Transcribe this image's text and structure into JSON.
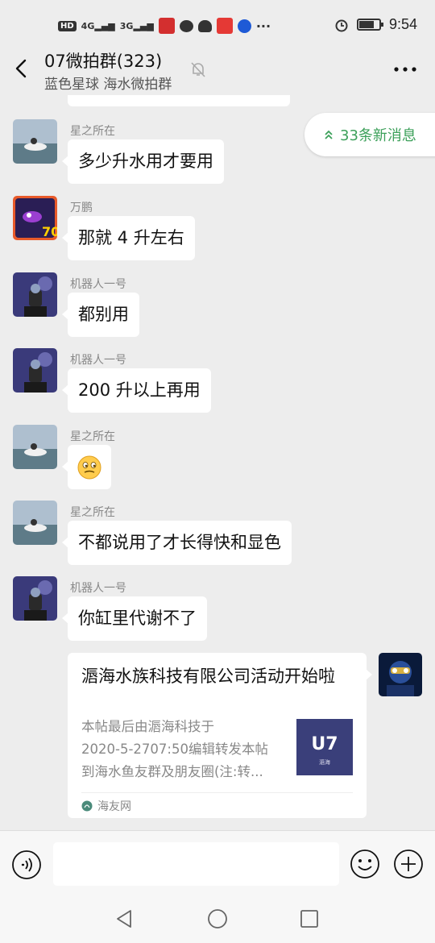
{
  "status_bar": {
    "time": "9:54",
    "network_1": "4G",
    "network_2": "3G",
    "hd_badge": "HD",
    "battery_level": 0.75,
    "icons": [
      "hd-icon",
      "signal-4g-icon",
      "signal-3g-icon",
      "app-notification-icon",
      "message-icon",
      "penguin-icon",
      "meituan-icon",
      "baidu-icon",
      "more-dots-icon",
      "alarm-icon",
      "battery-icon"
    ]
  },
  "header": {
    "title": "07微拍群(323)",
    "subtitle": "蓝色星球 海水微拍群",
    "icons": [
      "back-arrow-icon",
      "mute-bell-icon",
      "more-icon"
    ]
  },
  "new_messages_pill": {
    "label": "33条新消息",
    "color": "#3ca05a"
  },
  "messages": [
    {
      "sender": "星之所在",
      "text": "多少升水用才要用",
      "avatar": "seaside-avatar"
    },
    {
      "sender": "万鹏",
      "text": "那就 4 升左右",
      "avatar": "fish-avatar"
    },
    {
      "sender": "机器人一号",
      "text": "都别用",
      "avatar": "robot-avatar"
    },
    {
      "sender": "机器人一号",
      "text": "200 升以上再用",
      "avatar": "robot-avatar"
    },
    {
      "sender": "星之所在",
      "text": "",
      "emoji": "smirk-emoji",
      "avatar": "seaside-avatar"
    },
    {
      "sender": "星之所在",
      "text": "不都说用了才长得快和显色",
      "avatar": "seaside-avatar"
    },
    {
      "sender": "机器人一号",
      "text": "你缸里代谢不了",
      "avatar": "robot-avatar"
    }
  ],
  "link_card": {
    "title": "滣海水族科技有限公司活动开始啦",
    "description_lines": [
      "本帖最后由滣海科技于",
      "2020-5-2707:50编辑转发本帖",
      "到海水鱼友群及朋友圈(注:转..."
    ],
    "source": "海友网",
    "thumb_logo_text": "U7",
    "thumb_small_text": "滣海",
    "thumb_color": "#3a3f7a"
  },
  "input_bar": {
    "placeholder": "",
    "icons": [
      "voice-icon",
      "emoji-icon",
      "plus-icon"
    ]
  },
  "nav_bar": {
    "icons": [
      "nav-back-icon",
      "nav-home-icon",
      "nav-recent-icon"
    ]
  },
  "colors": {
    "background": "#ededed",
    "bubble": "#ffffff",
    "accent_green": "#3ca05a"
  }
}
